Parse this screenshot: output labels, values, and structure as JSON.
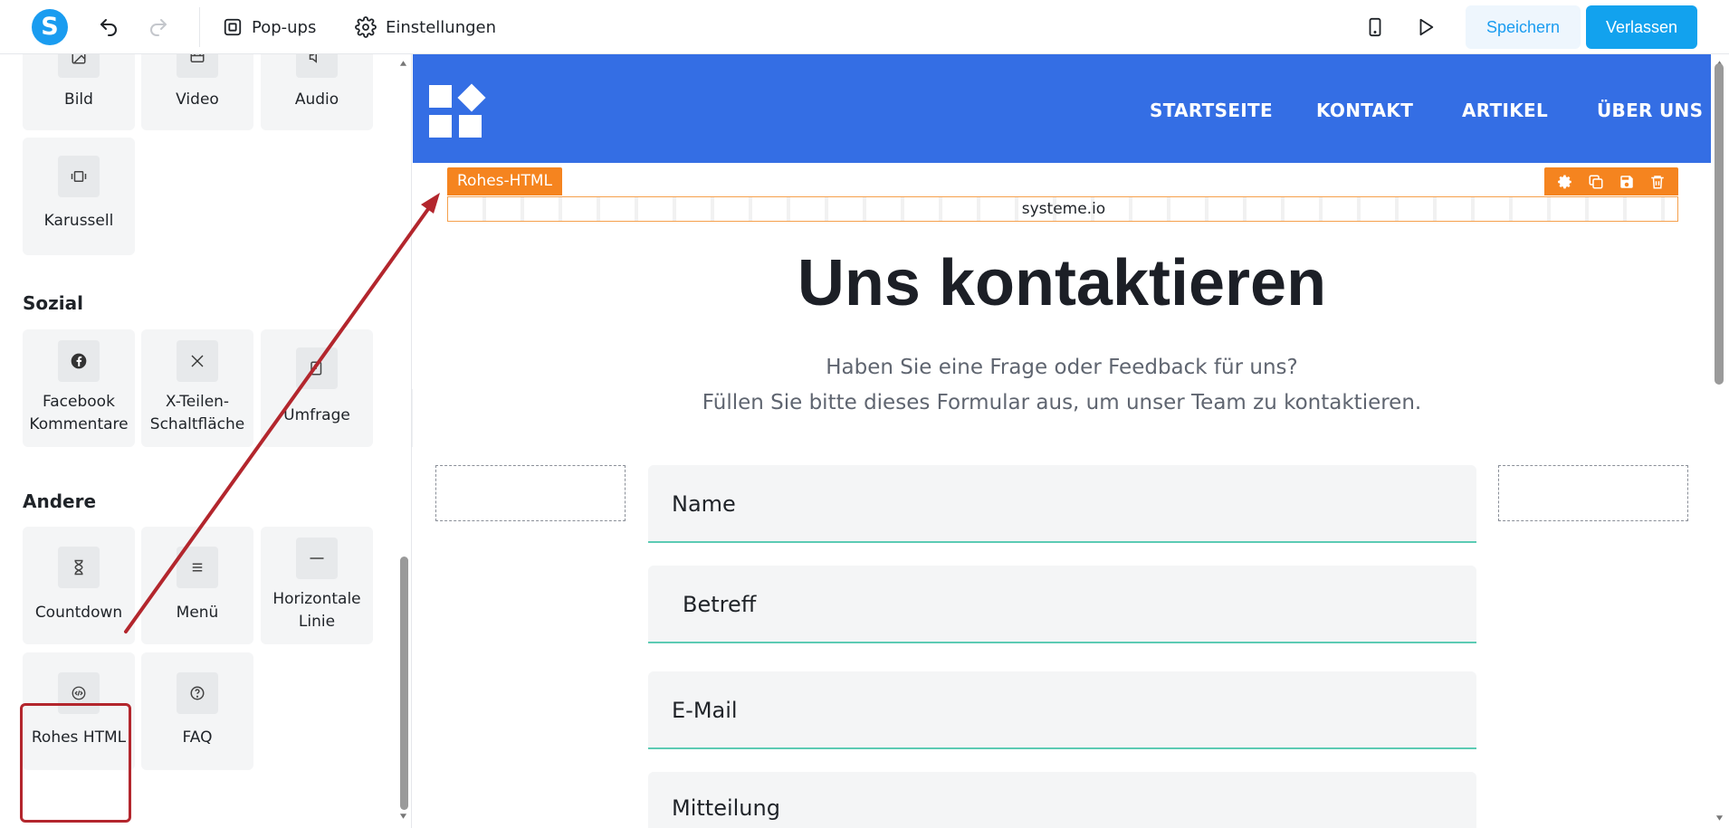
{
  "toolbar": {
    "logo_letter": "S",
    "popups_label": "Pop-ups",
    "settings_label": "Einstellungen",
    "save_label": "Speichern",
    "leave_label": "Verlassen",
    "icons": [
      "undo-icon",
      "redo-icon",
      "mobile-preview-icon",
      "play-preview-icon"
    ]
  },
  "sidebar": {
    "media_tiles": [
      {
        "label": "Bild",
        "icon": "image-icon"
      },
      {
        "label": "Video",
        "icon": "video-icon"
      },
      {
        "label": "Audio",
        "icon": "audio-icon"
      },
      {
        "label": "Karussell",
        "icon": "carousel-icon"
      }
    ],
    "social_title": "Sozial",
    "social_tiles": [
      {
        "label_line1": "Facebook",
        "label_line2": "Kommentare",
        "icon": "facebook-icon"
      },
      {
        "label_line1": "X-Teilen-",
        "label_line2": "Schaltfläche",
        "icon": "x-icon"
      },
      {
        "label": "Umfrage",
        "icon": "survey-icon"
      }
    ],
    "other_title": "Andere",
    "other_tiles": [
      {
        "label": "Countdown",
        "icon": "hourglass-icon"
      },
      {
        "label": "Menü",
        "icon": "menu-icon"
      },
      {
        "label_line1": "Horizontale",
        "label_line2": "Linie",
        "icon": "horizontal-line-icon"
      },
      {
        "label": "Rohes HTML",
        "icon": "code-icon"
      },
      {
        "label": "FAQ",
        "icon": "question-icon"
      }
    ]
  },
  "canvas": {
    "nav": [
      "STARTSEITE",
      "KONTAKT",
      "ARTIKEL",
      "ÜBER UNS"
    ],
    "raw_html_label": "Rohes-HTML",
    "raw_html_content": "systeme.io",
    "title": "Uns kontaktieren",
    "subtitle_line1": "Haben Sie eine Frage oder Feedback für uns?",
    "subtitle_line2": "Füllen Sie bitte dieses Formular aus, um unser Team zu kontaktieren.",
    "fields": [
      "Name",
      "Betreff",
      "E-Mail",
      "Mitteilung"
    ]
  },
  "colors": {
    "brand_blue": "#1a9cf0",
    "header_blue": "#346ee4",
    "raw_html_orange": "#f5841f",
    "field_underline": "#5ccbb4",
    "highlight_red": "#b3262d"
  }
}
